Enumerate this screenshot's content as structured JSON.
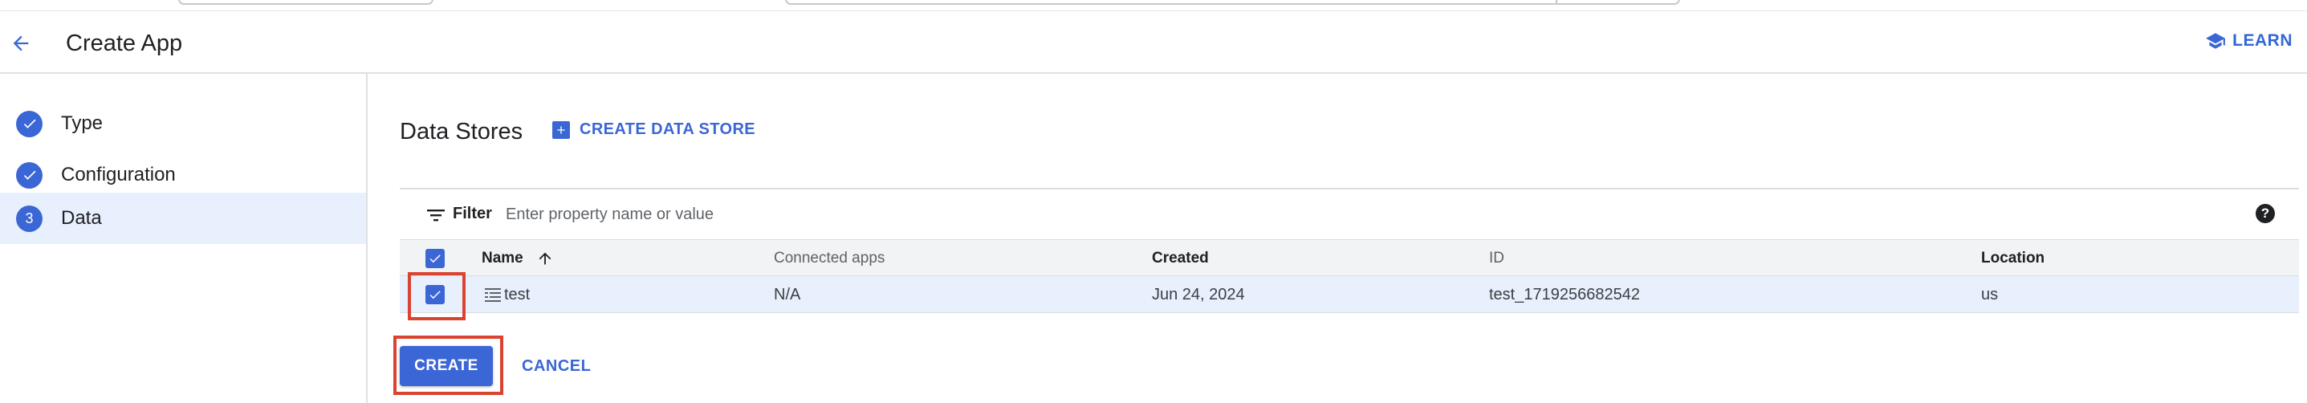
{
  "header": {
    "title": "Create App",
    "learn_label": "LEARN"
  },
  "sidebar": {
    "steps": [
      {
        "label": "Type",
        "state": "done"
      },
      {
        "label": "Configuration",
        "state": "done"
      },
      {
        "label": "Data",
        "state": "active",
        "number": "3"
      }
    ]
  },
  "main": {
    "section_title": "Data Stores",
    "create_data_store_label": "CREATE DATA STORE",
    "filter": {
      "label": "Filter",
      "placeholder": "Enter property name or value",
      "help": "?"
    },
    "table": {
      "columns": [
        "Name",
        "Connected apps",
        "Created",
        "ID",
        "Location"
      ],
      "rows": [
        {
          "name": "test",
          "connected_apps": "N/A",
          "created": "Jun 24, 2024",
          "id": "test_1719256682542",
          "location": "us",
          "selected": true
        }
      ]
    },
    "create_label": "CREATE",
    "cancel_label": "CANCEL"
  },
  "colors": {
    "accent": "#3b66d6",
    "highlight": "#d9432f",
    "selected_row": "#e8f0fe"
  }
}
